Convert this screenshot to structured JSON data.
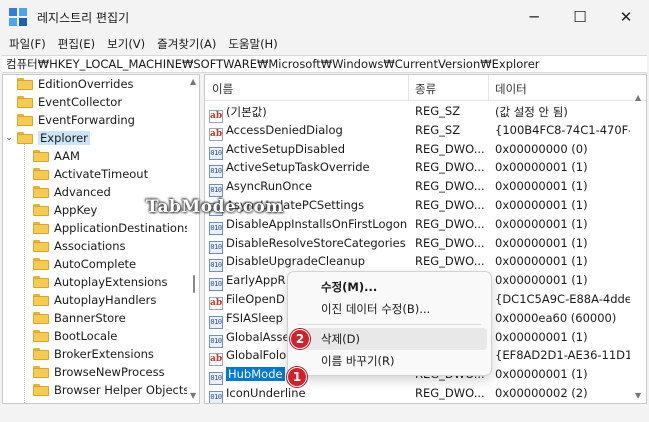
{
  "window": {
    "title": "레지스트리 편집기",
    "minimize": "─",
    "maximize": "☐",
    "close": "✕"
  },
  "menu": [
    "파일(F)",
    "편집(E)",
    "보기(V)",
    "즐겨찾기(A)",
    "도움말(H)"
  ],
  "address": "컴퓨터₩HKEY_LOCAL_MACHINE₩SOFTWARE₩Microsoft₩Windows₩CurrentVersion₩Explorer",
  "tree": {
    "parents": [
      "EditionOverrides",
      "EventCollector",
      "EventForwarding"
    ],
    "selected": "Explorer",
    "children": [
      "AAM",
      "ActivateTimeout",
      "Advanced",
      "AppKey",
      "ApplicationDestinations",
      "Associations",
      "AutoComplete",
      "AutoplayExtensions",
      "AutoplayHandlers",
      "BannerStore",
      "BootLocale",
      "BrokerExtensions",
      "BrowseNewProcess",
      "Browser Helper Objects"
    ]
  },
  "list": {
    "columns": [
      "이름",
      "종류",
      "데이터"
    ],
    "rows": [
      {
        "icon": "string",
        "name": "(기본값)",
        "type": "REG_SZ",
        "data": "(값 설정 안 됨)"
      },
      {
        "icon": "string",
        "name": "AccessDeniedDialog",
        "type": "REG_SZ",
        "data": "{100B4FC8-74C1-470F-E"
      },
      {
        "icon": "binary",
        "name": "ActiveSetupDisabled",
        "type": "REG_DWO...",
        "data": "0x00000000 (0)"
      },
      {
        "icon": "binary",
        "name": "ActiveSetupTaskOverride",
        "type": "REG_DWO...",
        "data": "0x00000001 (1)"
      },
      {
        "icon": "binary",
        "name": "AsyncRunOnce",
        "type": "REG_DWO...",
        "data": "0x00000001 (1)"
      },
      {
        "icon": "binary",
        "name": "AsyncUpdatePCSettings",
        "type": "REG_DWO...",
        "data": "0x00000001 (1)"
      },
      {
        "icon": "binary",
        "name": "DisableAppInstallsOnFirstLogon",
        "type": "REG_DWO...",
        "data": "0x00000001 (1)"
      },
      {
        "icon": "binary",
        "name": "DisableResolveStoreCategories",
        "type": "REG_DWO...",
        "data": "0x00000001 (1)"
      },
      {
        "icon": "binary",
        "name": "DisableUpgradeCleanup",
        "type": "REG_DWO...",
        "data": "0x00000001 (1)"
      },
      {
        "icon": "binary",
        "name": "EarlyAppR",
        "type": "",
        "data": "0x00000001 (1)"
      },
      {
        "icon": "string",
        "name": "FileOpenD",
        "type": "",
        "data": "{DC1C5A9C-E88A-4dde-"
      },
      {
        "icon": "binary",
        "name": "FSIASleep",
        "type": "",
        "data": "0x0000ea60 (60000)"
      },
      {
        "icon": "binary",
        "name": "GlobalAsse",
        "type": "",
        "data": "0x00000001 (1)"
      },
      {
        "icon": "string",
        "name": "GlobalFolo",
        "type": "",
        "data": "{EF8AD2D1-AE36-11D1-"
      },
      {
        "icon": "binary",
        "name": "HubMode",
        "type": "REG_DWO...",
        "data": "0x00000001 (1)"
      },
      {
        "icon": "binary",
        "name": "IconUnderline",
        "type": "REG_DWO...",
        "data": "0x00000002 (2)"
      }
    ]
  },
  "context_menu": {
    "items": [
      "수정(M)...",
      "이진 데이터 수정(B)...",
      "삭제(D)",
      "이름 바꾸기(R)"
    ]
  },
  "badges": [
    "2",
    "1"
  ],
  "watermark": "TabMode.com",
  "colors": {
    "selection": "#0078d4",
    "badge": "#d3202b",
    "folder": "#f6cb4f"
  }
}
